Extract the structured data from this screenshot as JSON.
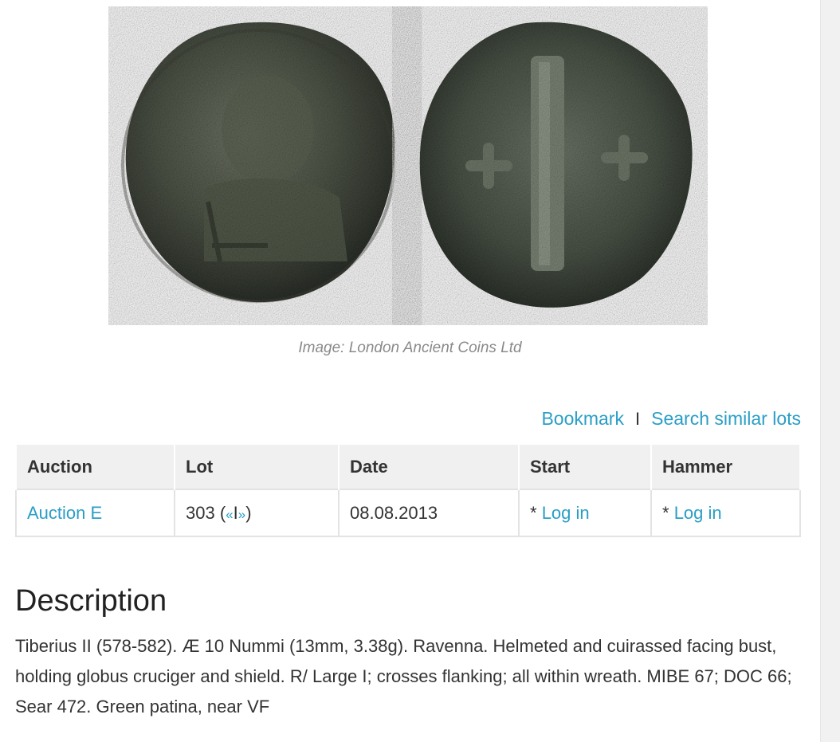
{
  "image": {
    "alt": "Coin obverse and reverse",
    "caption": "Image: London Ancient Coins Ltd"
  },
  "actions": {
    "bookmark": "Bookmark",
    "separator": "I",
    "search_similar": "Search similar lots"
  },
  "table": {
    "headers": [
      "Auction",
      "Lot",
      "Date",
      "Start",
      "Hammer"
    ],
    "row": {
      "auction": "Auction E",
      "lot_number": "303",
      "lot_prefix": " (",
      "prev": "«",
      "nav_sep": "I",
      "next": "»",
      "lot_suffix": ")",
      "date": "08.08.2013",
      "start_star": "* ",
      "start_login": "Log in",
      "hammer_star": "* ",
      "hammer_login": "Log in"
    }
  },
  "description": {
    "title": "Description",
    "text": "Tiberius II (578-582). Æ 10 Nummi (13mm, 3.38g). Ravenna. Helmeted and cuirassed facing bust, holding globus cruciger and shield. R/ Large I; crosses flanking; all within wreath. MIBE 67; DOC 66; Sear 472. Green patina, near VF"
  },
  "colors": {
    "link": "#2a9ec6",
    "header_bg": "#f0f0f0",
    "caption": "#8a8a8a"
  }
}
